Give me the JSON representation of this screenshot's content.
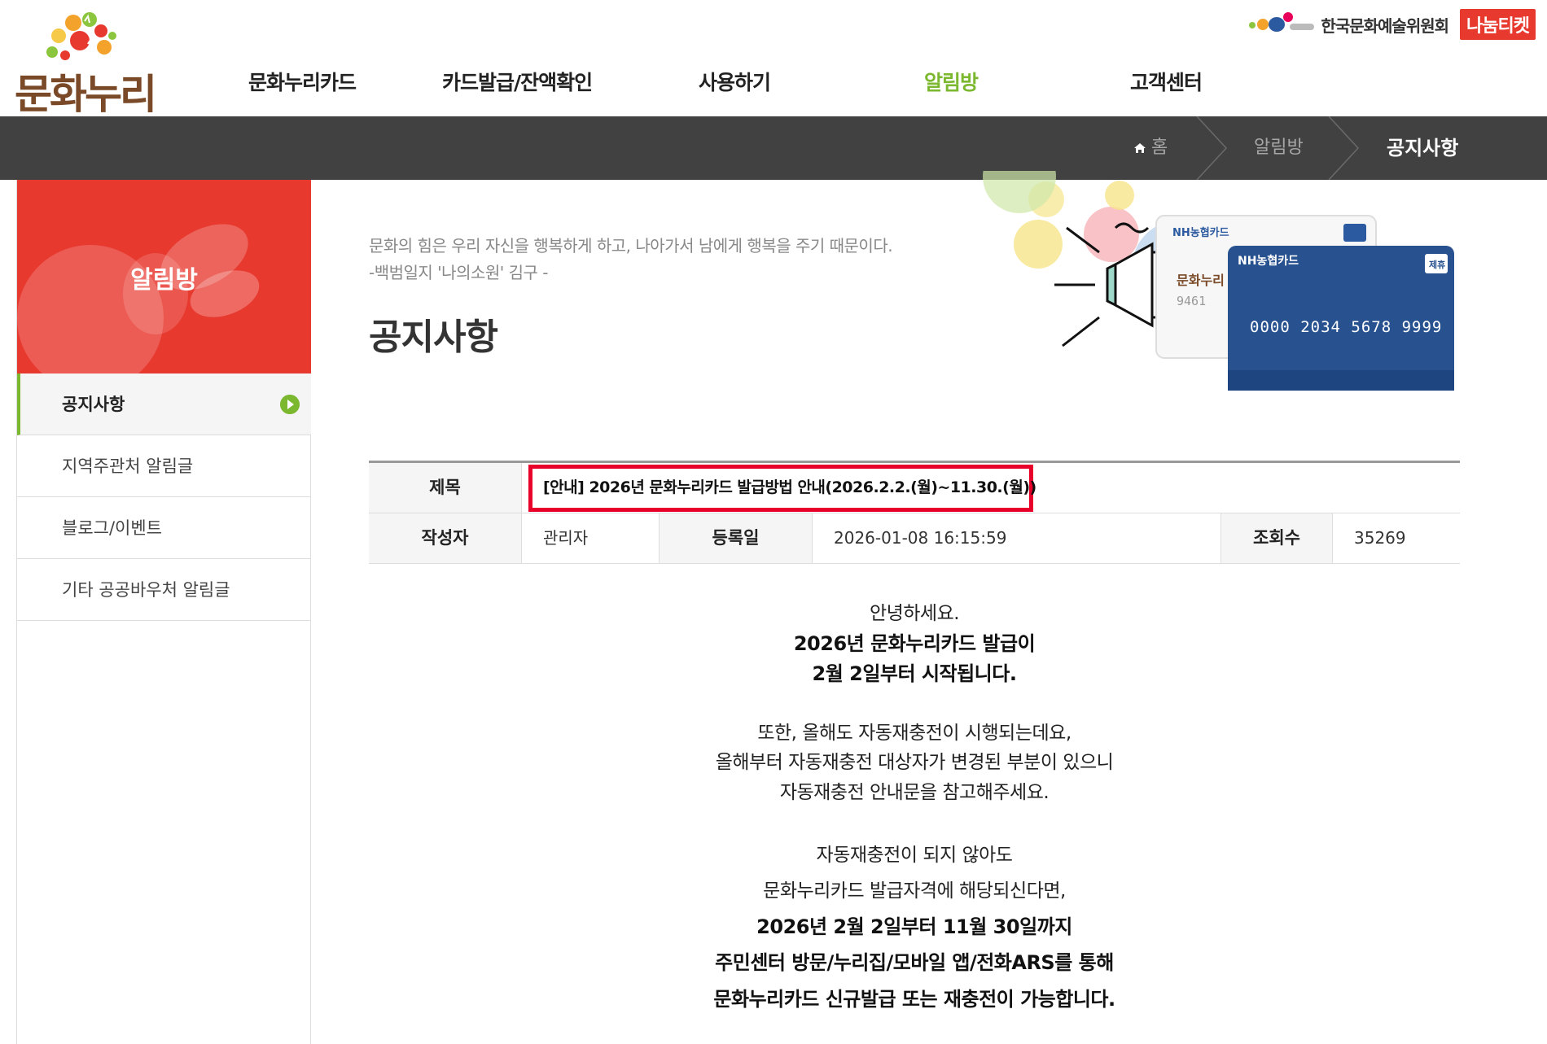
{
  "header": {
    "logo_text": "문화누리",
    "nav": [
      "문화누리카드",
      "카드발급/잔액확인",
      "사용하기",
      "알림방",
      "고객센터"
    ],
    "nav_active_index": 3,
    "org_name": "한국문화예술위원회",
    "ticket_label": "나눔티켓"
  },
  "breadcrumb": {
    "home": "홈",
    "section": "알림방",
    "current": "공지사항"
  },
  "sidebar": {
    "title": "알림방",
    "items": [
      "공지사항",
      "지역주관처 알림글",
      "블로그/이벤트",
      "기타 공공바우처 알림글"
    ],
    "active_index": 0
  },
  "content": {
    "quote_line1": "문화의 힘은 우리 자신을 행복하게 하고, 나아가서 남에게 행복을 주기 때문이다.",
    "quote_line2": "-백범일지 '나의소원' 김구 -",
    "page_title": "공지사항"
  },
  "hero": {
    "card_brand": "NH농협카드",
    "card_number": "0000 2034 5678 9999",
    "card_badge": "제휴",
    "card_logo": "문화누리"
  },
  "post": {
    "label_title": "제목",
    "title": "[안내] 2026년 문화누리카드 발급방법 안내(2026.2.2.(월)~11.30.(월))",
    "label_author": "작성자",
    "author": "관리자",
    "label_date": "등록일",
    "date": "2026-01-08 16:15:59",
    "label_views": "조회수",
    "views": "35269",
    "body": [
      "안녕하세요.",
      "2026년 문화누리카드 발급이",
      "2월 2일부터 시작됩니다.",
      "또한, 올해도 자동재충전이 시행되는데요,",
      "올해부터 자동재충전 대상자가 변경된 부분이 있으니",
      "자동재충전 안내문을 참고해주세요.",
      "자동재충전이 되지 않아도",
      "문화누리카드 발급자격에 해당되신다면,",
      "2026년 2월 2일부터 11월 30일까지",
      "주민센터 방문/누리집/모바일 앱/전화ARS를 통해",
      "문화누리카드 신규발급 또는 재충전이 가능합니다."
    ]
  },
  "colors": {
    "accent_green": "#7cb82f",
    "accent_red": "#e8392f",
    "highlight_red": "#e8002a",
    "bar_dark": "#414141"
  }
}
